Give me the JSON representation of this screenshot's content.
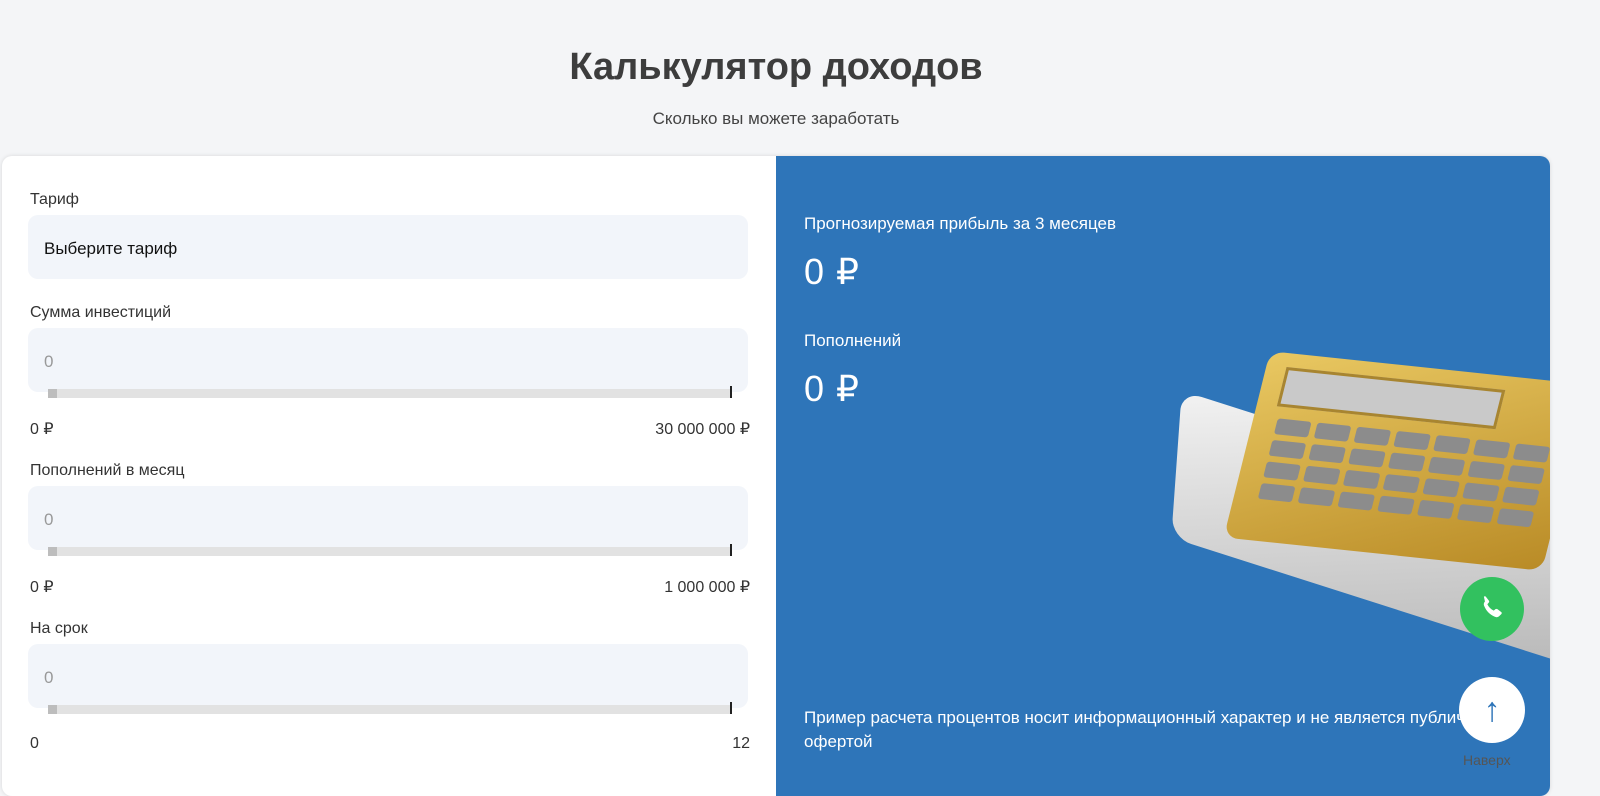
{
  "header": {
    "title": "Калькулятор доходов",
    "subtitle": "Сколько вы можете заработать"
  },
  "form": {
    "tariff": {
      "label": "Тариф",
      "value": "Выберите тариф"
    },
    "investment": {
      "label": "Сумма инвестиций",
      "value": "0",
      "min": "0 ₽",
      "max": "30 000 000 ₽",
      "slider_fraction": 0
    },
    "monthly": {
      "label": "Пополнений в месяц",
      "value": "0",
      "min": "0 ₽",
      "max": "1 000 000 ₽",
      "slider_fraction": 0
    },
    "term": {
      "label": "На срок",
      "value": "0",
      "min": "0",
      "max": "12",
      "slider_fraction": 0
    }
  },
  "result": {
    "profit_label": "Прогнозируемая прибыль за 3 месяцев",
    "profit_value": "0 ₽",
    "topups_label": "Пополнений",
    "topups_value": "0 ₽",
    "disclaimer": "Пример расчета процентов носит информационный характер и не является публичной офертой"
  },
  "floating": {
    "back_to_top": "Наверх"
  },
  "colors": {
    "accent": "#2e75b9",
    "whatsapp": "#32c15f"
  }
}
